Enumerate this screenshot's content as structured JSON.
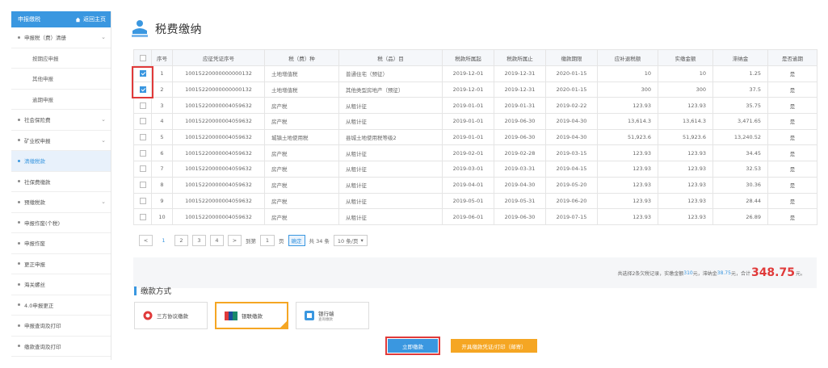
{
  "sidebar": {
    "header_title": "申报缴税",
    "home_label": "返回主页",
    "items": [
      {
        "label": "申报税（费）清册",
        "has_children": true,
        "level": 1
      },
      {
        "label": "按期应申报",
        "has_children": false,
        "level": 2
      },
      {
        "label": "其他申报",
        "has_children": false,
        "level": 2
      },
      {
        "label": "逾期申报",
        "has_children": false,
        "level": 2
      },
      {
        "label": "社会保险费",
        "has_children": true,
        "level": 1
      },
      {
        "label": "矿业权申报",
        "has_children": true,
        "level": 1
      },
      {
        "label": "清缴税款",
        "has_children": false,
        "level": 1,
        "active": true
      },
      {
        "label": "社保费缴款",
        "has_children": false,
        "level": 1
      },
      {
        "label": "预缴税款",
        "has_children": true,
        "level": 1
      },
      {
        "label": "申报作废(个税)",
        "has_children": false,
        "level": 1
      },
      {
        "label": "申报作废",
        "has_children": false,
        "level": 1
      },
      {
        "label": "更正申报",
        "has_children": false,
        "level": 1
      },
      {
        "label": "海关螺丝",
        "has_children": false,
        "level": 1
      },
      {
        "label": "4.0申报更正",
        "has_children": false,
        "level": 1
      },
      {
        "label": "申报查询及打印",
        "has_children": false,
        "level": 1
      },
      {
        "label": "缴款查询及打印",
        "has_children": false,
        "level": 1
      }
    ]
  },
  "page": {
    "title": "税费缴纳"
  },
  "table": {
    "headers": [
      "序号",
      "应征凭证序号",
      "税（费）种",
      "税（品）目",
      "税款所属起",
      "税款所属止",
      "缴款期限",
      "应补退税额",
      "实缴金额",
      "滞纳金",
      "是否逾期"
    ],
    "rows": [
      {
        "checked": true,
        "no": "1",
        "voucher": "10015220000000000132",
        "tax": "土地增值税",
        "item": "普通住宅（预征）",
        "start": "2019-12-01",
        "end": "2019-12-31",
        "due": "2020-01-15",
        "payable": "10",
        "paid": "10",
        "late": "1.25",
        "overdue": "是"
      },
      {
        "checked": true,
        "no": "2",
        "voucher": "10015220000000000132",
        "tax": "土地增值税",
        "item": "其他类型房地产（预征）",
        "start": "2019-12-01",
        "end": "2019-12-31",
        "due": "2020-01-15",
        "payable": "300",
        "paid": "300",
        "late": "37.5",
        "overdue": "是"
      },
      {
        "checked": false,
        "no": "3",
        "voucher": "10015220000004059632",
        "tax": "房产税",
        "item": "从租计征",
        "start": "2019-01-01",
        "end": "2019-01-31",
        "due": "2019-02-22",
        "payable": "123.93",
        "paid": "123.93",
        "late": "35.75",
        "overdue": "是"
      },
      {
        "checked": false,
        "no": "4",
        "voucher": "10015220000004059632",
        "tax": "房产税",
        "item": "从租计征",
        "start": "2019-01-01",
        "end": "2019-06-30",
        "due": "2019-04-30",
        "payable": "13,614.3",
        "paid": "13,614.3",
        "late": "3,471.65",
        "overdue": "是"
      },
      {
        "checked": false,
        "no": "5",
        "voucher": "10015220000004059632",
        "tax": "城镇土地使用税",
        "item": "县城土地使用税等级2",
        "start": "2019-01-01",
        "end": "2019-06-30",
        "due": "2019-04-30",
        "payable": "51,923.6",
        "paid": "51,923.6",
        "late": "13,240.52",
        "overdue": "是"
      },
      {
        "checked": false,
        "no": "6",
        "voucher": "10015220000004059632",
        "tax": "房产税",
        "item": "从租计征",
        "start": "2019-02-01",
        "end": "2019-02-28",
        "due": "2019-03-15",
        "payable": "123.93",
        "paid": "123.93",
        "late": "34.45",
        "overdue": "是"
      },
      {
        "checked": false,
        "no": "7",
        "voucher": "10015220000004059632",
        "tax": "房产税",
        "item": "从租计征",
        "start": "2019-03-01",
        "end": "2019-03-31",
        "due": "2019-04-15",
        "payable": "123.93",
        "paid": "123.93",
        "late": "32.53",
        "overdue": "是"
      },
      {
        "checked": false,
        "no": "8",
        "voucher": "10015220000004059632",
        "tax": "房产税",
        "item": "从租计征",
        "start": "2019-04-01",
        "end": "2019-04-30",
        "due": "2019-05-20",
        "payable": "123.93",
        "paid": "123.93",
        "late": "30.36",
        "overdue": "是"
      },
      {
        "checked": false,
        "no": "9",
        "voucher": "10015220000004059632",
        "tax": "房产税",
        "item": "从租计征",
        "start": "2019-05-01",
        "end": "2019-05-31",
        "due": "2019-06-20",
        "payable": "123.93",
        "paid": "123.93",
        "late": "28.44",
        "overdue": "是"
      },
      {
        "checked": false,
        "no": "10",
        "voucher": "10015220000004059632",
        "tax": "房产税",
        "item": "从租计征",
        "start": "2019-06-01",
        "end": "2019-06-30",
        "due": "2019-07-15",
        "payable": "123.93",
        "paid": "123.93",
        "late": "26.89",
        "overdue": "是"
      }
    ]
  },
  "pager": {
    "prev": "<",
    "pages": [
      "1",
      "2",
      "3",
      "4"
    ],
    "current": "1",
    "next": ">",
    "goto_prefix": "到第",
    "goto_value": "1",
    "goto_suffix": "页",
    "confirm": "确定",
    "total": "共 34 条",
    "page_size": "10 条/页"
  },
  "summary": {
    "prefix": "共选择2条欠税记录，实缴金额",
    "paid_amount": "310",
    "paid_unit": "元，滞纳金",
    "late_amount": "38.75",
    "late_unit": "元，合计",
    "total": "348.75",
    "total_unit": "元。"
  },
  "payment": {
    "title": "缴款方式",
    "options": [
      {
        "label": "三方协议缴款",
        "sub": "",
        "selected": false
      },
      {
        "label": "银联缴款",
        "sub": "",
        "selected": true
      },
      {
        "label": "银行端",
        "sub": "查询缴款",
        "selected": false
      }
    ],
    "pay_button": "立即缴款",
    "print_button": "开具缴款凭证/打印（邮寄）"
  },
  "colors": {
    "accent": "#3a97e0",
    "highlight": "#e03a3a",
    "selected_border": "#f5a623"
  }
}
